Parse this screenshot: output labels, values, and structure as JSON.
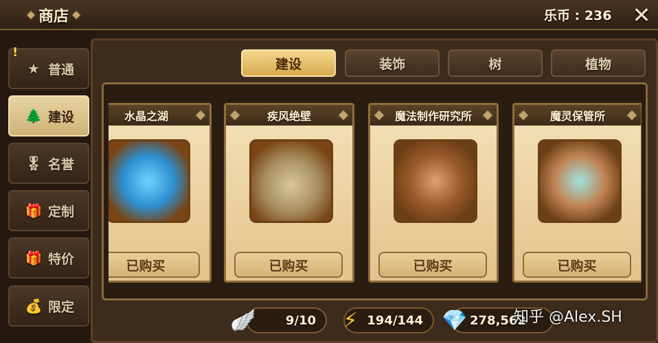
{
  "header": {
    "title": "商店",
    "coins_label": "乐币 : 236",
    "close_symbol": "✕"
  },
  "sidebar": {
    "items": [
      {
        "label": "普通",
        "icon": "star-icon",
        "glyph": "★",
        "badge": "!"
      },
      {
        "label": "建设",
        "icon": "tree-icon",
        "glyph": "🌲"
      },
      {
        "label": "名誉",
        "icon": "medal-icon",
        "glyph": "🎖"
      },
      {
        "label": "定制",
        "icon": "gift-icon",
        "glyph": "🎁"
      },
      {
        "label": "特价",
        "icon": "present-icon",
        "glyph": "🎁"
      },
      {
        "label": "限定",
        "icon": "chest-icon",
        "glyph": "💰"
      }
    ],
    "active_index": 1
  },
  "tabs": [
    {
      "label": "建设"
    },
    {
      "label": "装饰"
    },
    {
      "label": "树"
    },
    {
      "label": "植物"
    }
  ],
  "active_tab": 0,
  "cards": [
    {
      "title": "水晶之湖",
      "button": "已购买",
      "image": "crystal-lake-image"
    },
    {
      "title": "疾风绝壁",
      "button": "已购买",
      "image": "gale-cliff-image"
    },
    {
      "title": "魔法制作研究所",
      "button": "已购买",
      "image": "magic-lab-image"
    },
    {
      "title": "魔灵保管所",
      "button": "已购买",
      "image": "monster-storage-image"
    }
  ],
  "resources": [
    {
      "icon": "wing-icon",
      "glyph": "🪽",
      "value": "9/10"
    },
    {
      "icon": "lightning-icon",
      "glyph": "⚡",
      "value": "194/144"
    },
    {
      "icon": "crystal-icon",
      "glyph": "💎",
      "value": "278,562"
    }
  ],
  "watermark": "知乎 @Alex.SH",
  "colors": {
    "active_tab": "#e2b25a",
    "active_nav": "#dcc48c",
    "card_bg": "#efd9a8",
    "panel_dark": "#2a1c10"
  }
}
